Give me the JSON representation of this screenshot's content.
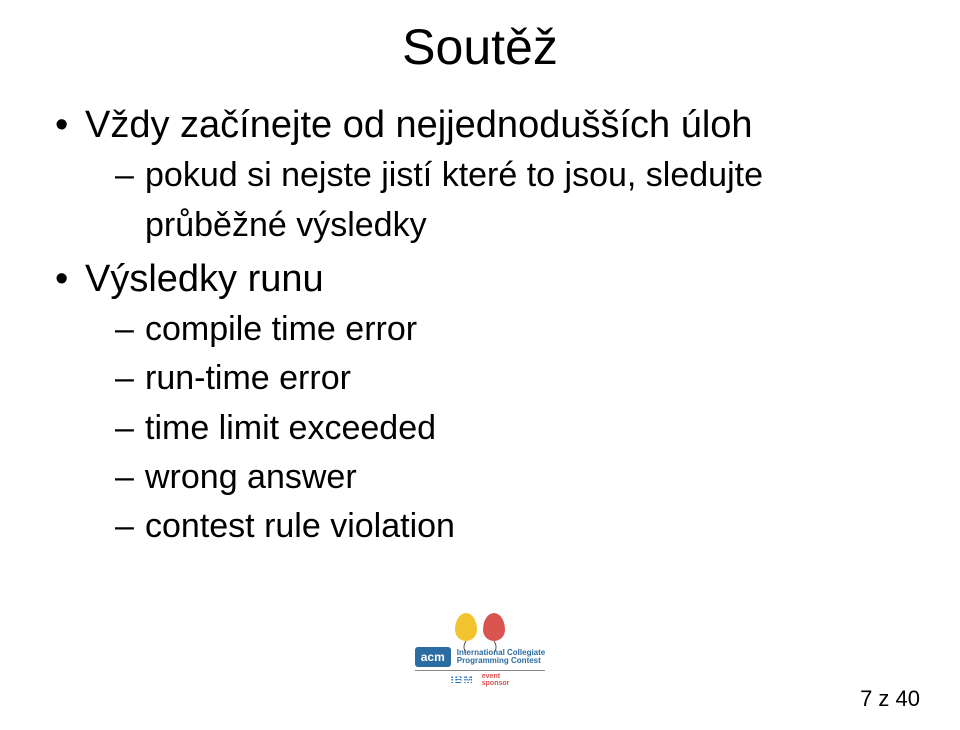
{
  "slide": {
    "title": "Soutěž",
    "bullets": [
      {
        "text": "Vždy začínejte od nejjednodušších úloh",
        "sub": [
          "pokud si nejste jistí které to jsou, sledujte průběžné výsledky"
        ]
      },
      {
        "text": "Výsledky runu",
        "sub": [
          "compile time error",
          "run-time error",
          "time limit exceeded",
          "wrong answer",
          "contest rule violation"
        ]
      }
    ]
  },
  "logo": {
    "acm": "acm",
    "icpc_line1": "International Collegiate",
    "icpc_line2": "Programming Contest",
    "ibm": "IBM",
    "sponsor_line1": "event",
    "sponsor_line2": "sponsor"
  },
  "footer": {
    "page": "7 z 40"
  }
}
